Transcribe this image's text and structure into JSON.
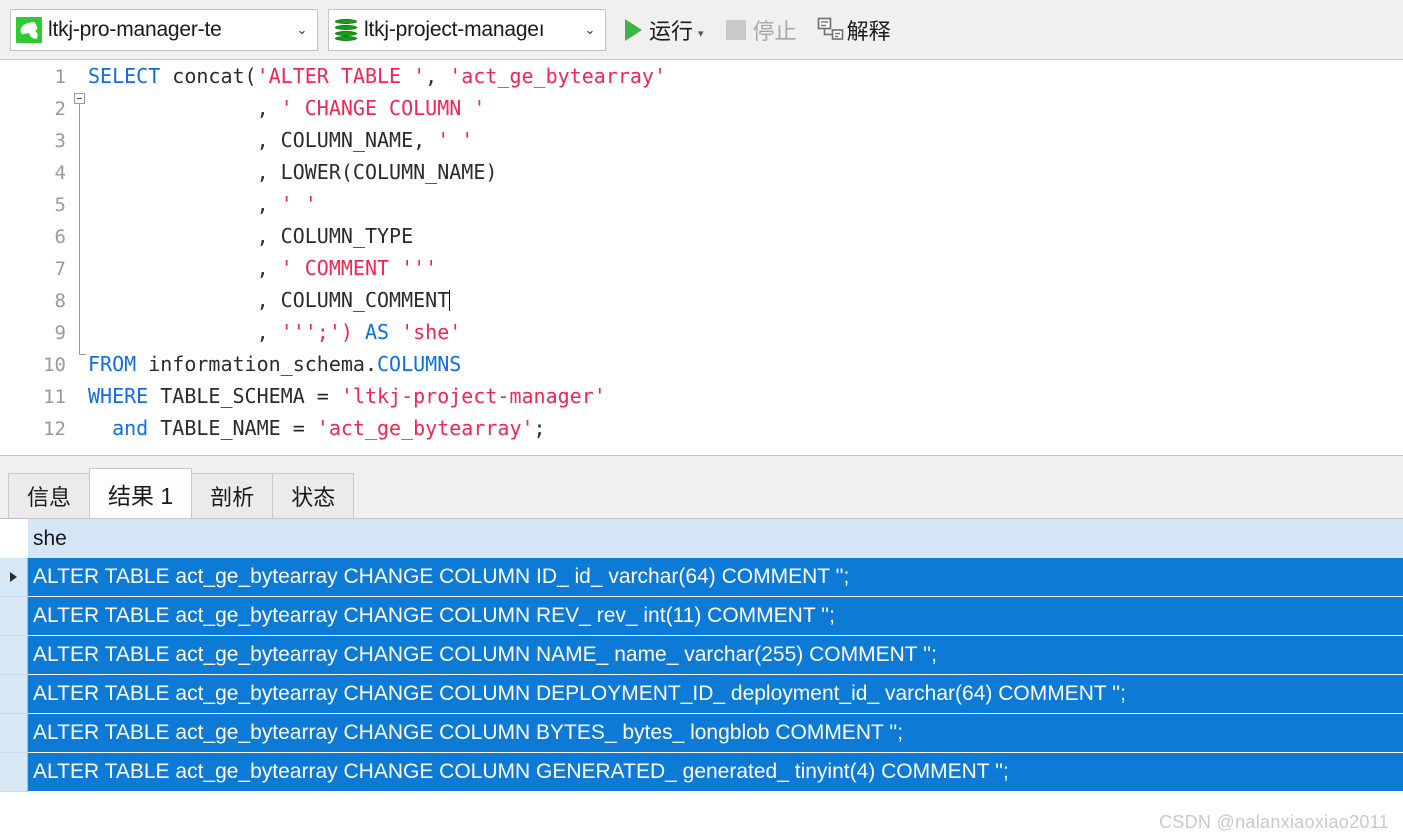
{
  "toolbar": {
    "connection": {
      "icon": "mysql-dolphin-icon",
      "value": "ltkj-pro-manager-te",
      "arrow": "⌄"
    },
    "database": {
      "icon": "database-cylinder-icon",
      "value": "ltkj-project-manageı",
      "arrow": "⌄"
    },
    "run_label": "运行",
    "run_caret": "▾",
    "stop_label": "停止",
    "explain_label": "解释",
    "accent_green": "#3cb54a",
    "disabled_gray": "#a8a8a8"
  },
  "editor": {
    "lines": [
      {
        "n": "1",
        "tokens": [
          {
            "t": "SELECT",
            "c": "kw"
          },
          {
            "t": " concat(",
            "c": ""
          },
          {
            "t": "'ALTER TABLE '",
            "c": "str"
          },
          {
            "t": ", ",
            "c": ""
          },
          {
            "t": "'act_ge_bytearray'",
            "c": "str"
          }
        ]
      },
      {
        "n": "2",
        "tokens": [
          {
            "t": "              , ",
            "c": ""
          },
          {
            "t": "' CHANGE COLUMN '",
            "c": "str"
          }
        ]
      },
      {
        "n": "3",
        "tokens": [
          {
            "t": "              , COLUMN_NAME, ",
            "c": ""
          },
          {
            "t": "' '",
            "c": "str"
          }
        ]
      },
      {
        "n": "4",
        "tokens": [
          {
            "t": "              , LOWER(COLUMN_NAME)",
            "c": ""
          }
        ]
      },
      {
        "n": "5",
        "tokens": [
          {
            "t": "              , ",
            "c": ""
          },
          {
            "t": "' '",
            "c": "str"
          }
        ]
      },
      {
        "n": "6",
        "tokens": [
          {
            "t": "              , COLUMN_TYPE",
            "c": ""
          }
        ]
      },
      {
        "n": "7",
        "tokens": [
          {
            "t": "              , ",
            "c": ""
          },
          {
            "t": "' COMMENT '''",
            "c": "str"
          }
        ]
      },
      {
        "n": "8",
        "tokens": [
          {
            "t": "              , COLUMN_COMMENT",
            "c": ""
          }
        ],
        "caret": true
      },
      {
        "n": "9",
        "tokens": [
          {
            "t": "              , ",
            "c": ""
          },
          {
            "t": "''';')",
            "c": "str"
          },
          {
            "t": " ",
            "c": ""
          },
          {
            "t": "AS",
            "c": "kw"
          },
          {
            "t": " ",
            "c": ""
          },
          {
            "t": "'she'",
            "c": "str"
          }
        ]
      },
      {
        "n": "10",
        "tokens": [
          {
            "t": "FROM",
            "c": "kw"
          },
          {
            "t": " information_schema.",
            "c": ""
          },
          {
            "t": "COLUMNS",
            "c": "kw"
          }
        ]
      },
      {
        "n": "11",
        "tokens": [
          {
            "t": "WHERE",
            "c": "kw"
          },
          {
            "t": " TABLE_SCHEMA = ",
            "c": ""
          },
          {
            "t": "'ltkj-project-manager'",
            "c": "str"
          }
        ]
      },
      {
        "n": "12",
        "tokens": [
          {
            "t": "  ",
            "c": ""
          },
          {
            "t": "and",
            "c": "kw"
          },
          {
            "t": " TABLE_NAME = ",
            "c": ""
          },
          {
            "t": "'act_ge_bytearray'",
            "c": "str"
          },
          {
            "t": ";",
            "c": ""
          }
        ]
      }
    ]
  },
  "result_tabs": [
    {
      "label": "信息",
      "active": false
    },
    {
      "label": "结果 1",
      "active": true
    },
    {
      "label": "剖析",
      "active": false
    },
    {
      "label": "状态",
      "active": false
    }
  ],
  "result_grid": {
    "columns": [
      "she"
    ],
    "selected_row_index": 0,
    "selection_color": "#0d7ad6",
    "header_color": "#d4e6f6",
    "rows": [
      "ALTER TABLE act_ge_bytearray CHANGE COLUMN ID_ id_ varchar(64) COMMENT '';",
      "ALTER TABLE act_ge_bytearray CHANGE COLUMN REV_ rev_ int(11) COMMENT '';",
      "ALTER TABLE act_ge_bytearray CHANGE COLUMN NAME_ name_ varchar(255) COMMENT '';",
      "ALTER TABLE act_ge_bytearray CHANGE COLUMN DEPLOYMENT_ID_ deployment_id_ varchar(64) COMMENT '';",
      "ALTER TABLE act_ge_bytearray CHANGE COLUMN BYTES_ bytes_ longblob COMMENT '';",
      "ALTER TABLE act_ge_bytearray CHANGE COLUMN GENERATED_ generated_ tinyint(4) COMMENT '';"
    ]
  },
  "watermark": "CSDN @nalanxiaoxiao2011"
}
